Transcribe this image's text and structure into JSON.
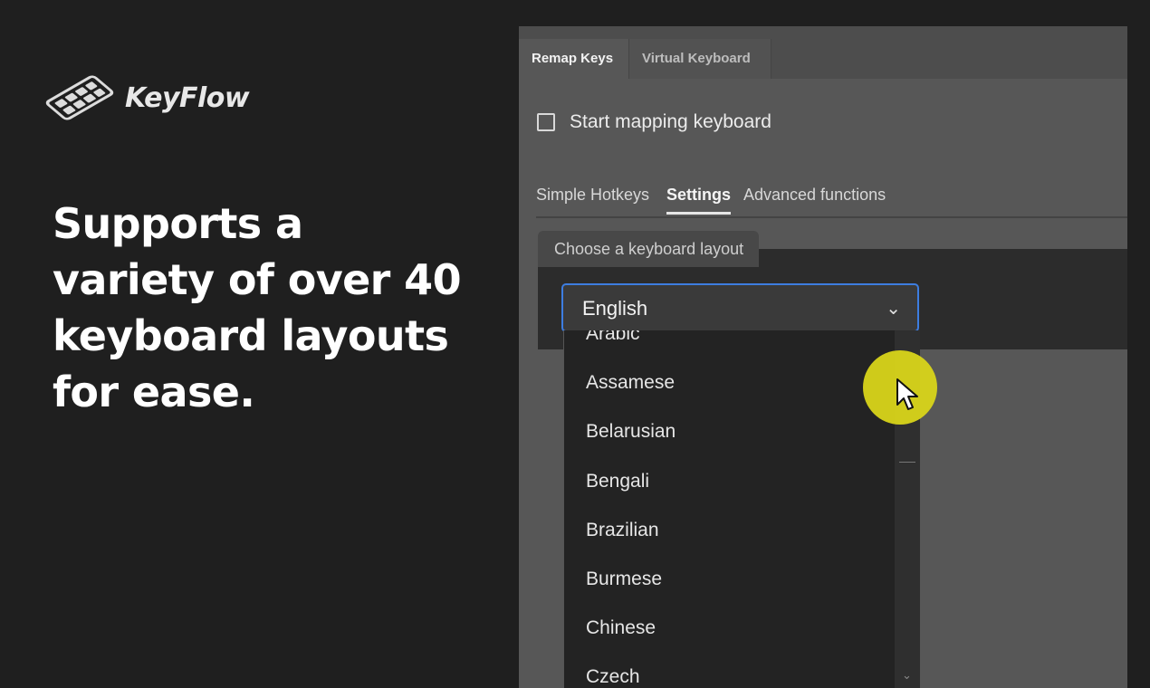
{
  "brand": {
    "name": "KeyFlow",
    "logo_icon": "keyboard-keys-icon"
  },
  "headline": "Supports a variety of over 40 keyboard layouts for ease.",
  "app": {
    "tabs": [
      {
        "label": "Remap Keys",
        "active": true
      },
      {
        "label": "Virtual Keyboard",
        "active": false
      }
    ],
    "start_mapping": {
      "label": "Start mapping keyboard",
      "checked": false
    },
    "subtabs": [
      {
        "label": "Simple Hotkeys",
        "active": false
      },
      {
        "label": "Settings",
        "active": true
      },
      {
        "label": "Advanced functions",
        "active": false
      }
    ],
    "layout_group": {
      "label": "Choose a keyboard layout",
      "selected": "English",
      "options": [
        "Arabic",
        "Assamese",
        "Belarusian",
        "Bengali",
        "Brazilian",
        "Burmese",
        "Chinese",
        "Czech"
      ]
    }
  },
  "colors": {
    "background": "#1f1f1f",
    "panel": "#575757",
    "select_border": "#3d7de0",
    "cursor_highlight": "#d9d51a"
  }
}
